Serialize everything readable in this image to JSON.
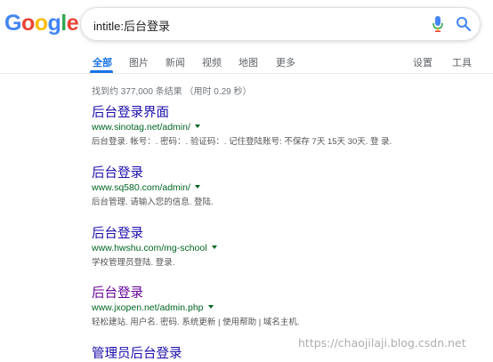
{
  "logo": {
    "letters": [
      "G",
      "o",
      "o",
      "g",
      "l",
      "e"
    ],
    "colors": [
      "#4285F4",
      "#EA4335",
      "#FBBC05",
      "#4285F4",
      "#34A853",
      "#EA4335"
    ]
  },
  "search": {
    "query": "intitle:后台登录",
    "mic_icon": "mic-icon",
    "search_icon": "search-icon"
  },
  "tabs": {
    "all": "全部",
    "images": "图片",
    "news": "新闻",
    "videos": "视频",
    "maps": "地图",
    "more": "更多",
    "settings": "设置",
    "tools": "工具",
    "active": "all",
    "accent": "#1a73e8"
  },
  "stats": "找到约 377,000 条结果 （用时 0.29 秒）",
  "results": [
    {
      "title": "后台登录界面",
      "url": "www.sinotag.net/admin/",
      "snippet": "后台登录. 帐号：. 密码：. 验证码：. 记住登陆账号: 不保存 7天 15天 30天. 登 录.",
      "visited": false
    },
    {
      "title": "后台登录",
      "url": "www.sq580.com/admin/",
      "snippet": "后台管理. 请输入您的信息. 登陆.",
      "visited": false
    },
    {
      "title": "后台登录",
      "url": "www.hwshu.com/mg-school",
      "snippet": "学校管理员登陆. 登录.",
      "visited": false
    },
    {
      "title": "后台登录",
      "url": "www.jxopen.net/admin.php",
      "snippet": "轻松建站. 用户名. 密码. 系统更新 | 使用帮助 | 域名主机.",
      "visited": true
    },
    {
      "title": "管理员后台登录",
      "url": "",
      "snippet": "",
      "visited": false
    }
  ],
  "watermark": "https://chaojilaji.blog.csdn.net"
}
